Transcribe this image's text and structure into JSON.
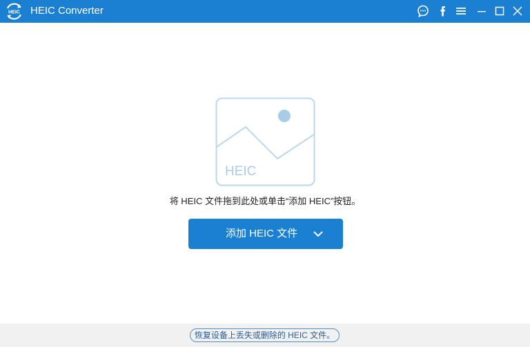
{
  "app": {
    "title": "HEIC Converter",
    "logo_icon": "heic-logo-icon",
    "accent_color": "#1b80d1"
  },
  "titlebar": {
    "buttons": [
      {
        "icon": "feedback-icon",
        "label": "Feedback"
      },
      {
        "icon": "facebook-icon",
        "label": "Facebook"
      },
      {
        "icon": "menu-icon",
        "label": "Menu"
      },
      {
        "icon": "minimize-icon",
        "label": "Minimize"
      },
      {
        "icon": "maximize-icon",
        "label": "Maximize"
      },
      {
        "icon": "close-icon",
        "label": "Close"
      }
    ]
  },
  "main": {
    "placeholder_label": "HEIC",
    "hint": "将 HEIC 文件拖到此处或单击“添加 HEIC”按钮。",
    "add_button": {
      "label": "添加 HEIC 文件",
      "dropdown_icon": "chevron-down-icon"
    }
  },
  "footer": {
    "recover_link": "恢复设备上丢失或删除的 HEIC 文件。"
  }
}
